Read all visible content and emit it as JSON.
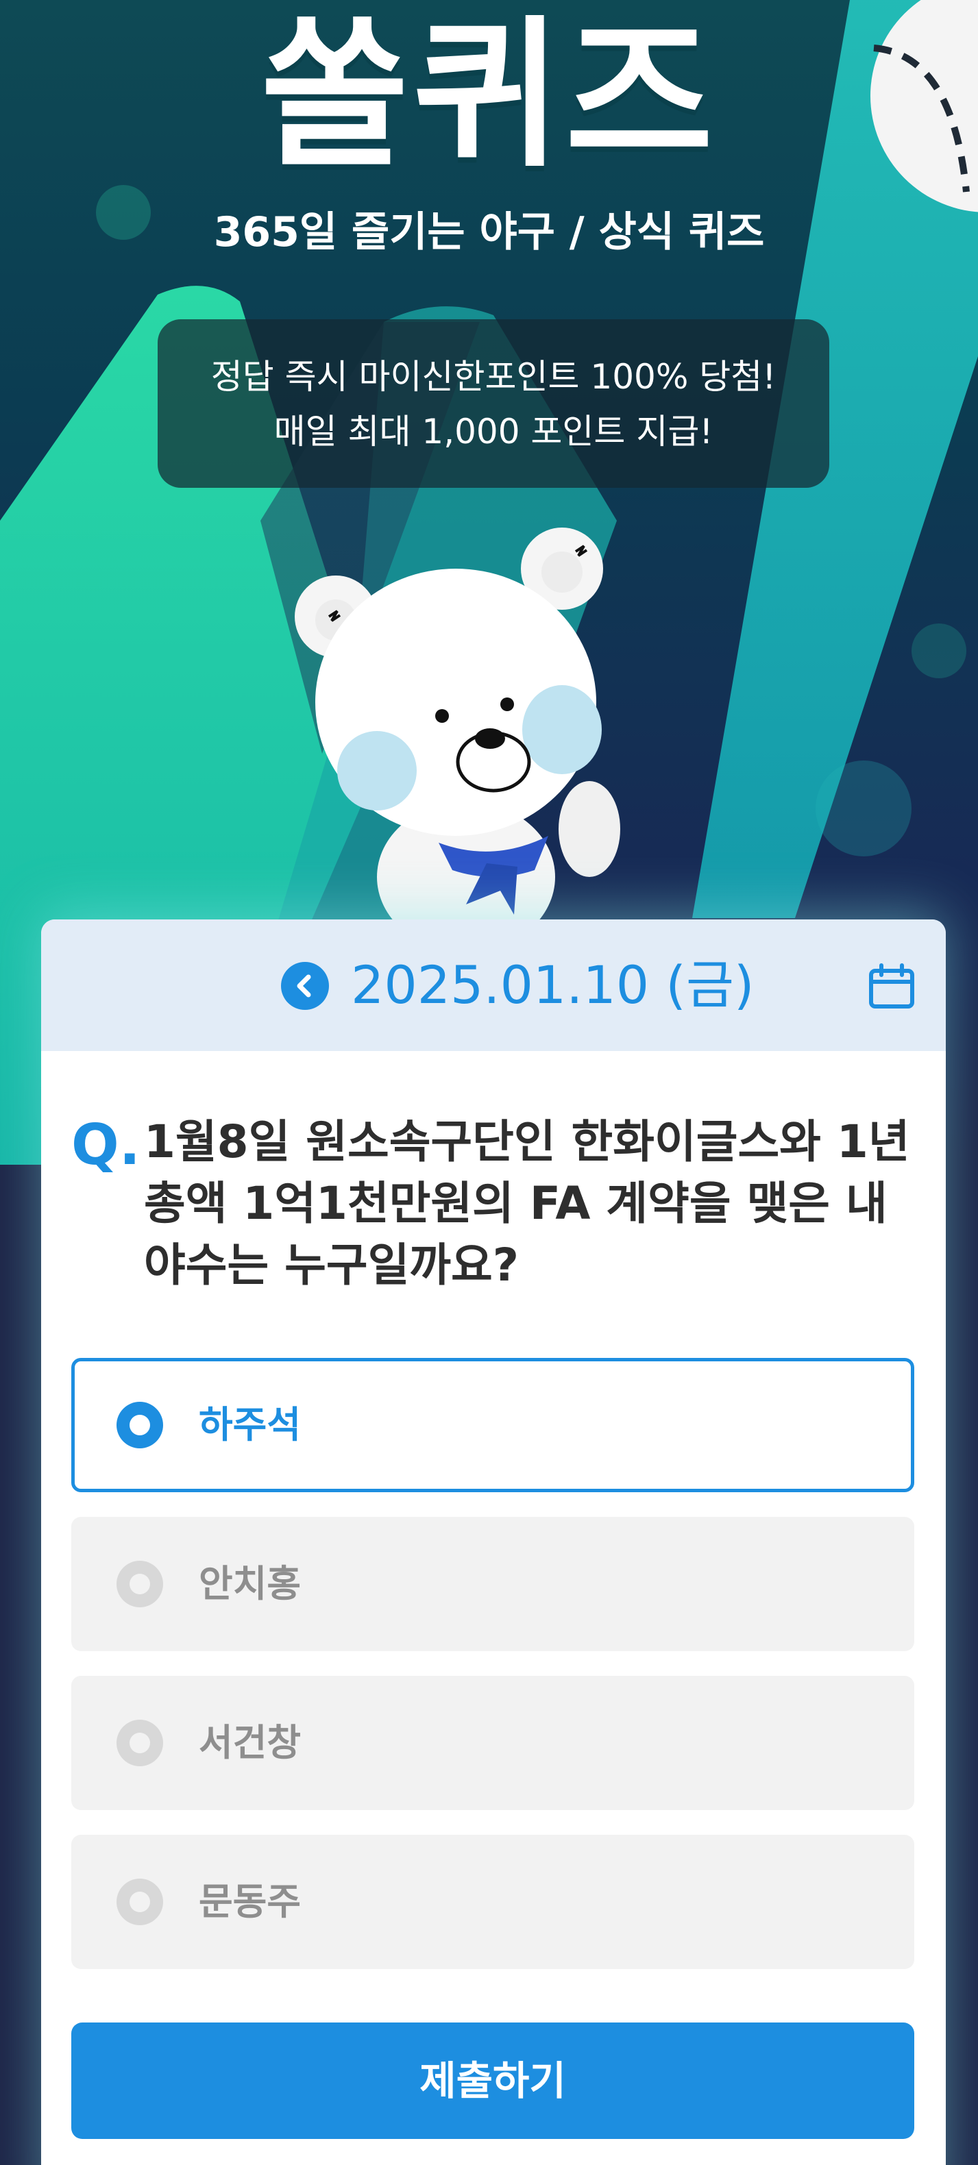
{
  "hero": {
    "title": "쏠퀴즈",
    "subtitle": "365일 즐기는 야구 / 상식 퀴즈",
    "promo_line1": "정답 즉시 마이신한포인트 100% 당첨!",
    "promo_line2": "매일 최대 1,000 포인트 지급!"
  },
  "date_bar": {
    "date": "2025.01.10 (금)",
    "prev_icon": "chevron-left-icon",
    "calendar_icon": "calendar-icon"
  },
  "question": {
    "mark": "Q.",
    "text": "1월8일 원소속구단인 한화이글스와 1년 총액 1억1천만원의 FA 계약을 맺은 내야수는 누구일까요?"
  },
  "options": [
    {
      "label": "하주석",
      "selected": true
    },
    {
      "label": "안치홍",
      "selected": false
    },
    {
      "label": "서건창",
      "selected": false
    },
    {
      "label": "문동주",
      "selected": false
    }
  ],
  "submit_label": "제출하기",
  "colors": {
    "accent": "#1d8ee0",
    "date_bar_bg": "#e2ecf7",
    "option_bg": "#f2f2f2",
    "hero_teal": "#2ad3a8"
  }
}
